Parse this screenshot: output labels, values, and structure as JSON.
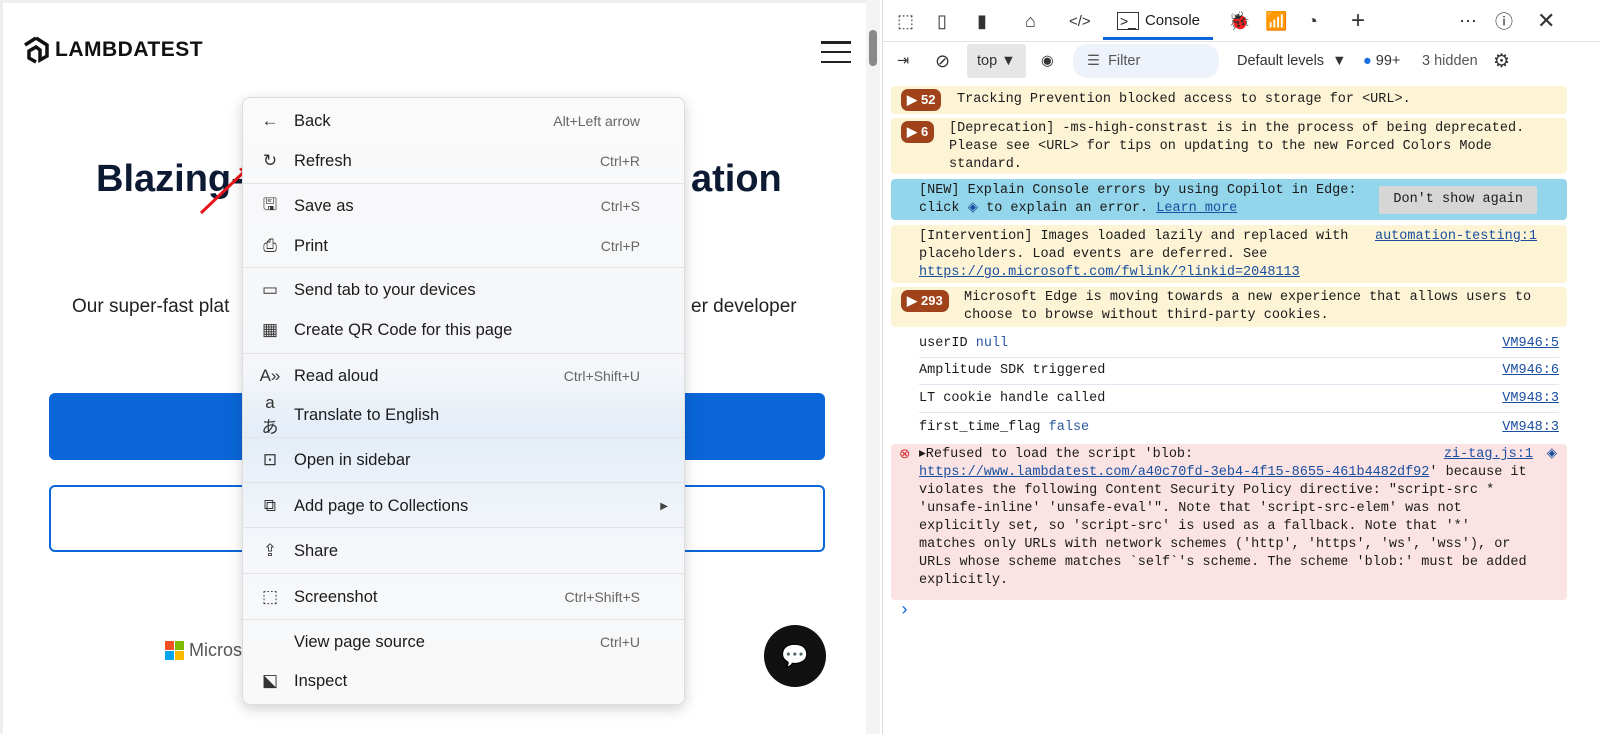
{
  "page": {
    "logo": "LAMBDATEST",
    "headline_left": "Blazing-",
    "headline_right": "ation",
    "subtitle_left": "Our super-fast plat",
    "subtitle_right": "er developer",
    "partner": "Microso"
  },
  "context_menu": {
    "items": [
      {
        "label": "Back",
        "shortcut": "Alt+Left arrow",
        "icon": "arrow-left-icon"
      },
      {
        "label": "Refresh",
        "shortcut": "Ctrl+R",
        "icon": "refresh-icon"
      },
      {
        "label": "Save as",
        "shortcut": "Ctrl+S",
        "icon": "save-icon"
      },
      {
        "label": "Print",
        "shortcut": "Ctrl+P",
        "icon": "print-icon"
      },
      {
        "label": "Send tab to your devices",
        "shortcut": "",
        "icon": "devices-icon"
      },
      {
        "label": "Create QR Code for this page",
        "shortcut": "",
        "icon": "qr-code-icon"
      },
      {
        "label": "Read aloud",
        "shortcut": "Ctrl+Shift+U",
        "icon": "read-aloud-icon"
      },
      {
        "label": "Translate to English",
        "shortcut": "",
        "icon": "translate-icon"
      },
      {
        "label": "Open in sidebar",
        "shortcut": "",
        "icon": "sidebar-icon"
      },
      {
        "label": "Add page to Collections",
        "shortcut": "",
        "icon": "collections-icon"
      },
      {
        "label": "Share",
        "shortcut": "",
        "icon": "share-icon"
      },
      {
        "label": "Screenshot",
        "shortcut": "Ctrl+Shift+S",
        "icon": "screenshot-icon"
      },
      {
        "label": "View page source",
        "shortcut": "Ctrl+U",
        "icon": ""
      },
      {
        "label": "Inspect",
        "shortcut": "",
        "icon": "inspect-icon"
      }
    ]
  },
  "devtools": {
    "console_tab": "Console",
    "context": "top",
    "filter_placeholder": "Filter",
    "levels": "Default levels",
    "issues_count": "99+",
    "hidden": "3 hidden",
    "messages": {
      "tracking": {
        "count": "52",
        "text": "Tracking Prevention blocked access to storage for <URL>."
      },
      "deprecation": {
        "count": "6",
        "text": "[Deprecation] -ms-high-constrast is in the process of being deprecated. Please see <URL> for tips on updating to the new Forced Colors Mode standard."
      },
      "copilot": {
        "text1": "[NEW] Explain Console errors by using Copilot in Edge:",
        "text2a": "click",
        "text2b": "to explain an error.",
        "link": "Learn more",
        "dismiss": "Don't show again"
      },
      "intervention": {
        "text": "[Intervention] Images loaded lazily and replaced with placeholders. Load events are deferred. See",
        "link": "https://go.microsoft.com/fwlink/?linkid=2048113",
        "source": "automation-testing:1"
      },
      "cookies": {
        "count": "293",
        "text": "Microsoft Edge is moving towards a new experience that allows users to choose to browse without third-party cookies."
      },
      "logs": [
        {
          "text": "userID",
          "value": "null",
          "source": "VM946:5"
        },
        {
          "text": "Amplitude SDK triggered",
          "value": "",
          "source": "VM946:6"
        },
        {
          "text": "LT cookie handle called",
          "value": "",
          "source": "VM948:3"
        },
        {
          "text": "first_time_flag",
          "value": "false",
          "source": "VM948:3"
        }
      ],
      "error": {
        "text1": "Refused to load the script 'blob:",
        "link": "https://www.lambdatest.com/a40c70fd-3eb4-4f15-8655-461b4482df92",
        "text2": "' because it violates the following Content Security Policy directive: \"script-src * 'unsafe-inline' 'unsafe-eval'\". Note that 'script-src-elem' was not explicitly set, so 'script-src' is used as a fallback. Note that '*' matches only URLs with network schemes ('http', 'https', 'ws', 'wss'), or URLs whose scheme matches `self`'s scheme. The scheme 'blob:' must be added explicitly.",
        "source": "zi-tag.js:1"
      }
    },
    "prompt": "›"
  },
  "colors": {
    "brand_blue": "#0a66d8",
    "annotation_red": "#e8141a",
    "warning_bg": "#fdf4d6",
    "error_bg": "#fbe3e3",
    "info_bg": "#93d5ea"
  }
}
